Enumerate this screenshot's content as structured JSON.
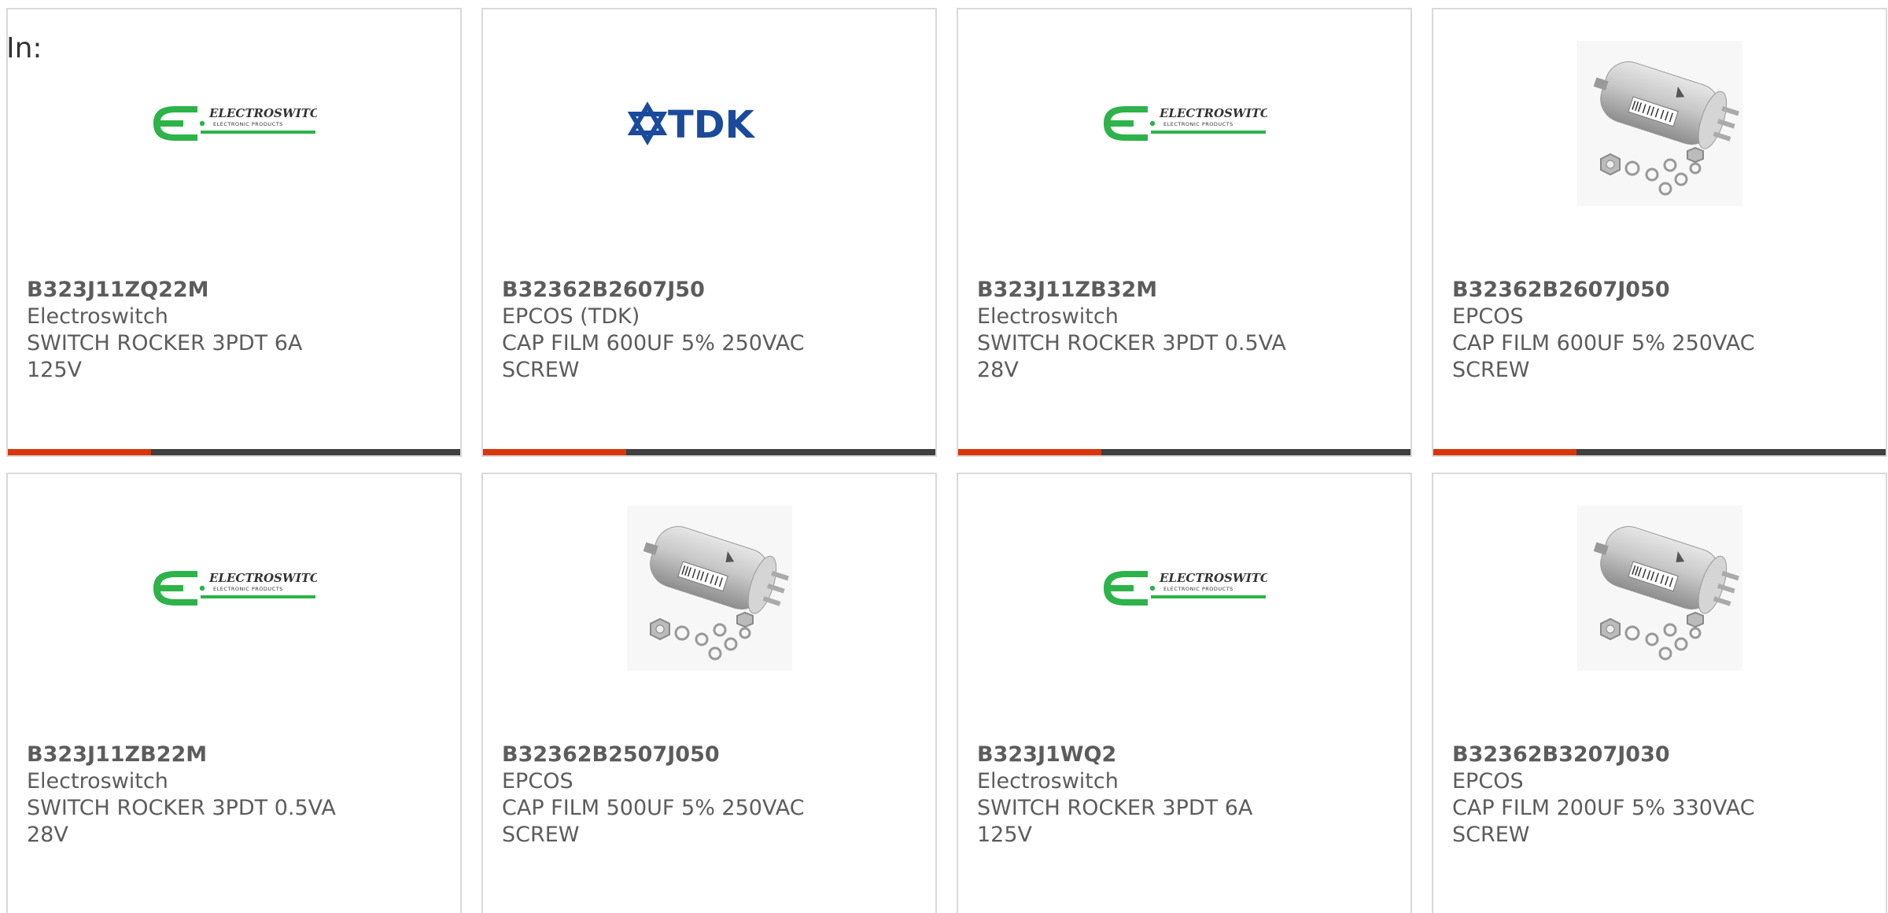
{
  "filter": {
    "label": "In:"
  },
  "products": [
    {
      "part": "B323J11ZQ22M",
      "manufacturer": "Electroswitch",
      "description": "SWITCH ROCKER 3PDT 6A 125V",
      "image": "electroswitch-logo"
    },
    {
      "part": "B32362B2607J50",
      "manufacturer": "EPCOS (TDK)",
      "description": "CAP FILM 600UF 5% 250VAC SCREW",
      "image": "tdk-logo"
    },
    {
      "part": "B323J11ZB32M",
      "manufacturer": "Electroswitch",
      "description": "SWITCH ROCKER 3PDT 0.5VA 28V",
      "image": "electroswitch-logo"
    },
    {
      "part": "B32362B2607J050",
      "manufacturer": "EPCOS",
      "description": "CAP FILM 600UF 5% 250VAC SCREW",
      "image": "film-capacitor-photo"
    },
    {
      "part": "B323J11ZB22M",
      "manufacturer": "Electroswitch",
      "description": "SWITCH ROCKER 3PDT 0.5VA 28V",
      "image": "electroswitch-logo"
    },
    {
      "part": "B32362B2507J050",
      "manufacturer": "EPCOS",
      "description": "CAP FILM 500UF 5% 250VAC SCREW",
      "image": "film-capacitor-photo"
    },
    {
      "part": "B323J1WQ2",
      "manufacturer": "Electroswitch",
      "description": "SWITCH ROCKER 3PDT 6A 125V",
      "image": "electroswitch-logo"
    },
    {
      "part": "B32362B3207J030",
      "manufacturer": "EPCOS",
      "description": "CAP FILM 200UF 5% 330VAC SCREW",
      "image": "film-capacitor-photo"
    }
  ],
  "logos": {
    "electroswitch": {
      "wordmark": "ELECTROSWITCH",
      "tagline": "ELECTRONIC PRODUCTS"
    },
    "tdk": {
      "wordmark": "TDK"
    }
  },
  "colors": {
    "accent": "#d9360b",
    "bar": "#3f3f3f",
    "electroswitch_green": "#2db34a",
    "tdk_blue": "#1a4a9c"
  }
}
